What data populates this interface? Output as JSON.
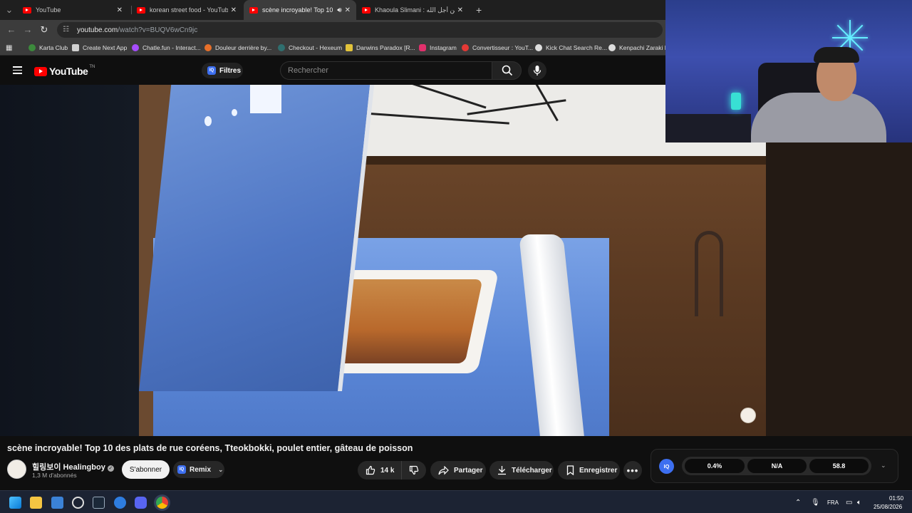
{
  "browser": {
    "tabs": [
      {
        "title": "YouTube",
        "active": false
      },
      {
        "title": "korean street food - YouTube",
        "active": false
      },
      {
        "title": "scène incroyable! Top 10 de",
        "active": true,
        "audio": true
      },
      {
        "title": "Khaoula Slimani : يه من أجل الله",
        "active": false
      }
    ],
    "new_tab_label": "+",
    "url_host": "youtube.com",
    "url_path": "/watch?v=BUQV6wCn9jc",
    "bookmarks": [
      {
        "label": "Karta Club",
        "color": "#3c8a3c"
      },
      {
        "label": "Create Next App",
        "color": "#d0d0d0"
      },
      {
        "label": "Chatle.fun - Interact...",
        "color": "#a64dff"
      },
      {
        "label": "Douleur derrière by...",
        "color": "#e8702a"
      },
      {
        "label": "Checkout - Hexeum",
        "color": "#2f6f6f"
      },
      {
        "label": "Darwins Paradox [R...",
        "color": "#e2c33a"
      },
      {
        "label": "Instagram",
        "color": "#e1306c"
      },
      {
        "label": "Convertisseur : YouT...",
        "color": "#e53935"
      },
      {
        "label": "Kick Chat Search Re...",
        "color": "#dddddd"
      },
      {
        "label": "Kenpachi Zaraki Bl",
        "color": "#dddddd"
      }
    ]
  },
  "youtube": {
    "logo_text": "YouTube",
    "logo_region": "TN",
    "filters_label": "Filtres",
    "iq_label": "IQ",
    "search_placeholder": "Rechercher"
  },
  "video": {
    "title": "scène incroyable! Top 10 des plats de rue coréens, Tteokbokki, poulet entier, gâteau de poisson",
    "channel_name": "힐링보이 Healingboy",
    "subscribers": "1,3 M d'abonnés",
    "subscribe_label": "S'abonner",
    "remix_label": "Remix",
    "likes": "14 k",
    "share_label": "Partager",
    "download_label": "Télécharger",
    "save_label": "Enregistrer"
  },
  "iq_panel": {
    "badge": "IQ",
    "values": [
      "0.4%",
      "N/A",
      "58.8"
    ]
  },
  "taskbar": {
    "language": "FRA",
    "time": "01:50",
    "date": "25/08/2026"
  }
}
